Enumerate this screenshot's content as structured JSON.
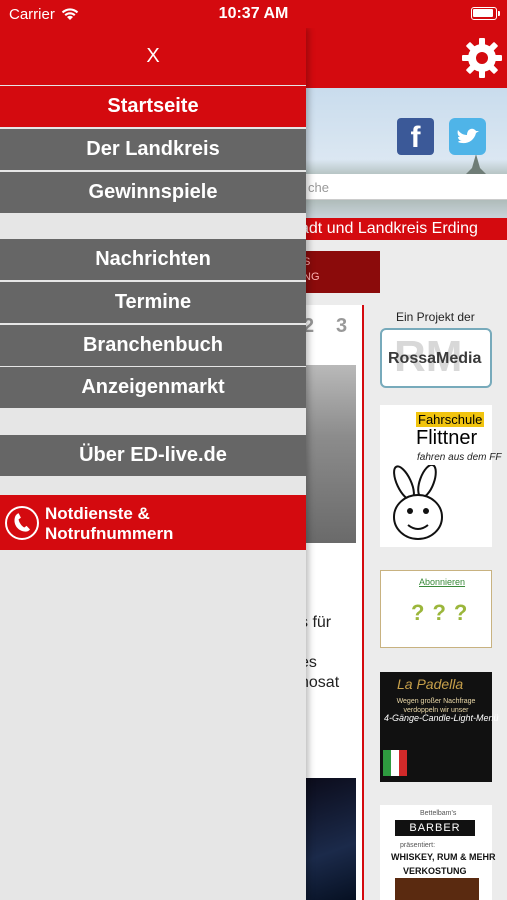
{
  "status_bar": {
    "carrier": "Carrier",
    "time": "10:37 AM"
  },
  "drawer": {
    "close_label": "X",
    "menu": [
      {
        "label": "Startseite",
        "active": true
      },
      {
        "label": "Der Landkreis"
      },
      {
        "label": "Gewinnspiele"
      },
      {
        "label": "Nachrichten"
      },
      {
        "label": "Termine"
      },
      {
        "label": "Branchenbuch"
      },
      {
        "label": "Anzeigenmarkt"
      },
      {
        "label": "Über ED-live.de"
      }
    ],
    "emergency": {
      "line1": "Notdienste &",
      "line2": "Notrufnummern"
    }
  },
  "background_page": {
    "search_placeholder": "che",
    "banner_text": "adt und Landkreis Erding",
    "dark_box_lines": [
      "S",
      "NG"
    ],
    "page_numbers": [
      "2",
      "3"
    ],
    "article_fragments": [
      "s für",
      "es",
      "hosat"
    ],
    "sidebar": {
      "project_label": "Ein Projekt der",
      "rossa_media": "RossaMedia",
      "rossa_bg": "RM",
      "fahrschule_top": "Fahrschule",
      "fahrschule_name": "Flittner",
      "fahrschule_slogan": "fahren aus dem FF",
      "abo_text": "Abonnieren",
      "abo_symbols": "???",
      "padella_title": "La Padella",
      "padella_note": "Wegen großer Nachfrage verdoppeln wir unser",
      "padella_menu": "4-Gänge-Candle-Light-Menü",
      "barber_small": "Bettelbam's",
      "barber_badge": "BARBER",
      "barber_sub": "präsentiert:",
      "barber_big": "WHISKEY, RUM & MEHR",
      "barber_verk": "VERKOSTUNG"
    }
  },
  "colors": {
    "brand_red": "#d40a0f",
    "menu_grey": "#666666",
    "drawer_bg": "#e6e6e6"
  },
  "icons": [
    "wifi-icon",
    "battery-icon",
    "gear-icon",
    "facebook-icon",
    "twitter-icon",
    "phone-icon"
  ]
}
